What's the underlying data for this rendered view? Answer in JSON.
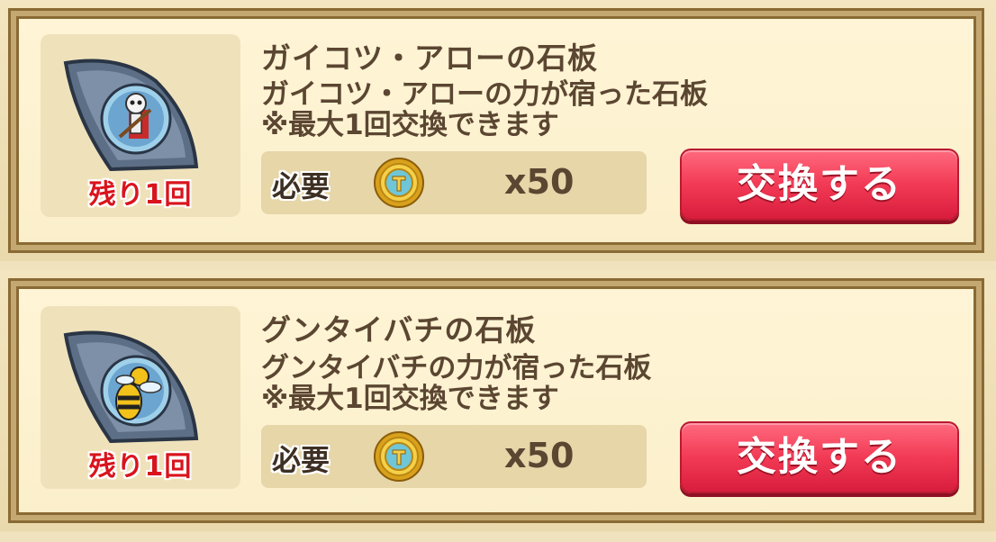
{
  "items": [
    {
      "title": "ガイコツ・アローの石板",
      "description": "ガイコツ・アローの力が宿った石板",
      "limit_note": "※最大1回交換できます",
      "remaining": "残り1回",
      "required_label": "必要",
      "cost": "x50",
      "button_label": "交換する",
      "icon": "skeleton-archer-stone-tablet-icon"
    },
    {
      "title": "グンタイバチの石板",
      "description": "グンタイバチの力が宿った石板",
      "limit_note": "※最大1回交換できます",
      "remaining": "残り1回",
      "required_label": "必要",
      "cost": "x50",
      "button_label": "交換する",
      "icon": "army-bee-stone-tablet-icon"
    }
  ],
  "colors": {
    "button": "#f23a55",
    "remaining_text": "#d9141d",
    "text": "#5b4632"
  }
}
